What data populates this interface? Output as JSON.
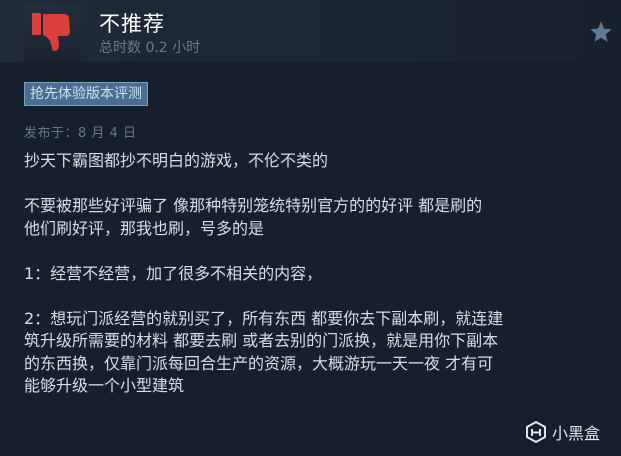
{
  "review": {
    "rating": "不推荐",
    "hours": "总时数 0.2 小时",
    "tag": "抢先体验版本评测",
    "posted": "发布于：8 月 4 日",
    "paragraphs": [
      [
        "抄天下霸图都抄不明白的游戏，不伦不类的"
      ],
      [
        "不要被那些好评骗了 像那种特别笼统特别官方的的好评 都是刷的",
        "他们刷好评，那我也刷，号多的是"
      ],
      [
        "1：经营不经营，加了很多不相关的内容，"
      ],
      [
        "2：想玩门派经营的就别买了，所有东西 都要你去下副本刷，就连建",
        "筑升级所需要的材料 都要去刷 或者去别的门派换，就是用你下副本",
        "的东西换，仅靠门派每回合生产的资源，大概游玩一天一夜 才有可",
        "能够升级一个小型建筑"
      ]
    ]
  },
  "watermark": {
    "text": "小黑盒"
  },
  "icons": {
    "rating": "thumbs-down-icon",
    "award": "star-icon",
    "watermark": "heybox-logo-icon"
  },
  "colors": {
    "thumb": "#d9403b",
    "tag_bg": "#4b6d8e",
    "background": "#16202d"
  }
}
